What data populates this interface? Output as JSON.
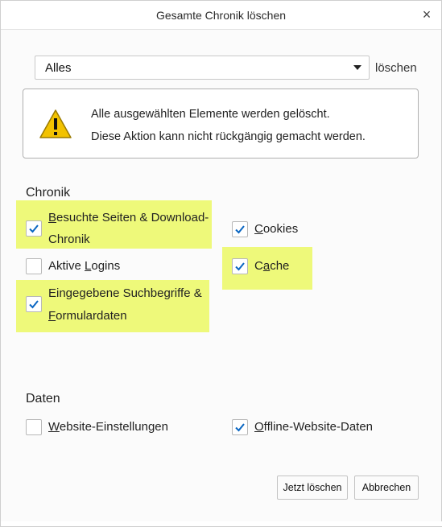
{
  "dialog": {
    "title": "Gesamte Chronik löschen",
    "close_glyph": "×"
  },
  "range": {
    "selected": "Alles",
    "suffix": "löschen"
  },
  "warning": {
    "icon": "warning-triangle-icon",
    "line1": "Alle ausgewählten Elemente werden gelöscht.",
    "line2": "Diese Aktion kann nicht rückgängig gemacht werden."
  },
  "chronik": {
    "heading": "Chronik",
    "items": {
      "besuchte": {
        "pre": "",
        "ul": "B",
        "post": "esuchte Seiten & Download-",
        "line2": "Chronik",
        "checked": true,
        "highlighted": true
      },
      "logins": {
        "pre": "Aktive ",
        "ul": "L",
        "post": "ogins",
        "checked": false,
        "highlighted": false
      },
      "such": {
        "pre": "Eingegebene Suchbegriffe &",
        "ul": "F",
        "post": "ormulardaten",
        "checked": true,
        "highlighted": true
      },
      "cookies": {
        "pre": "",
        "ul": "C",
        "post": "ookies",
        "checked": true,
        "highlighted": false
      },
      "cache": {
        "pre": "C",
        "ul": "a",
        "post": "che",
        "checked": true,
        "highlighted": true
      }
    }
  },
  "daten": {
    "heading": "Daten",
    "items": {
      "website": {
        "ul": "W",
        "post": "ebsite-Einstellungen",
        "checked": false
      },
      "offline": {
        "ul": "O",
        "post": "ffline-Website-Daten",
        "checked": true
      }
    }
  },
  "buttons": {
    "confirm": "Jetzt löschen",
    "cancel": "Abbrechen"
  },
  "colors": {
    "highlight": "#eef97a",
    "checkmark": "#0a66c2",
    "warning_fill": "#f2c200"
  }
}
